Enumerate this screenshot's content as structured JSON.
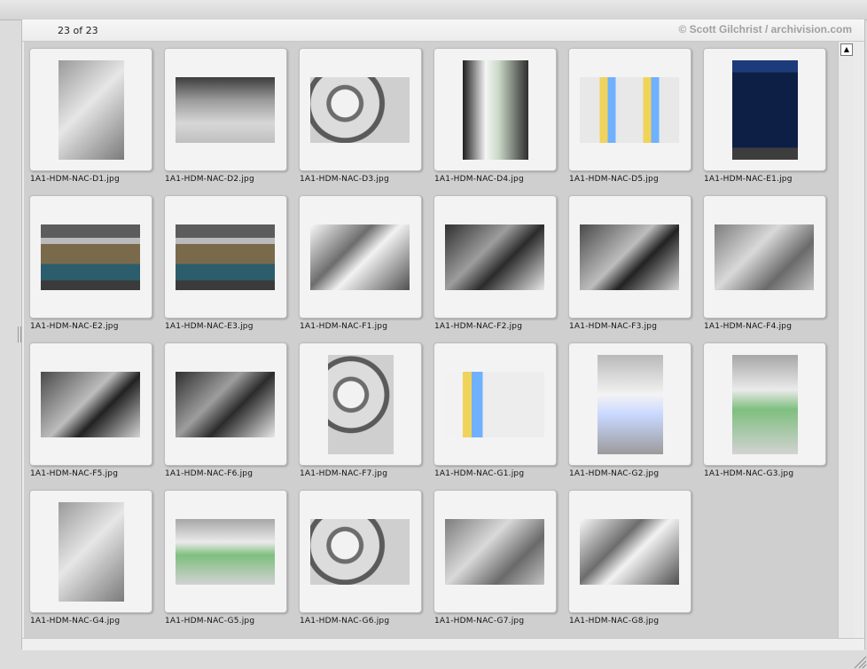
{
  "header": {
    "count": "23 of 23",
    "credit": "© Scott Gilchrist / archivision.com"
  },
  "thumbnails": [
    {
      "label": "1A1-HDM-NAC-D1.jpg",
      "icon": "photo-icon"
    },
    {
      "label": "1A1-HDM-NAC-D2.jpg",
      "icon": "photo-icon"
    },
    {
      "label": "1A1-HDM-NAC-D3.jpg",
      "icon": "photo-icon"
    },
    {
      "label": "1A1-HDM-NAC-D4.jpg",
      "icon": "photo-icon"
    },
    {
      "label": "1A1-HDM-NAC-D5.jpg",
      "icon": "photo-icon"
    },
    {
      "label": "1A1-HDM-NAC-E1.jpg",
      "icon": "photo-icon"
    },
    {
      "label": "1A1-HDM-NAC-E2.jpg",
      "icon": "photo-icon"
    },
    {
      "label": "1A1-HDM-NAC-E3.jpg",
      "icon": "photo-icon"
    },
    {
      "label": "1A1-HDM-NAC-F1.jpg",
      "icon": "photo-icon"
    },
    {
      "label": "1A1-HDM-NAC-F2.jpg",
      "icon": "photo-icon"
    },
    {
      "label": "1A1-HDM-NAC-F3.jpg",
      "icon": "photo-icon"
    },
    {
      "label": "1A1-HDM-NAC-F4.jpg",
      "icon": "photo-icon"
    },
    {
      "label": "1A1-HDM-NAC-F5.jpg",
      "icon": "photo-icon"
    },
    {
      "label": "1A1-HDM-NAC-F6.jpg",
      "icon": "photo-icon"
    },
    {
      "label": "1A1-HDM-NAC-F7.jpg",
      "icon": "photo-icon"
    },
    {
      "label": "1A1-HDM-NAC-G1.jpg",
      "icon": "photo-icon"
    },
    {
      "label": "1A1-HDM-NAC-G2.jpg",
      "icon": "photo-icon"
    },
    {
      "label": "1A1-HDM-NAC-G3.jpg",
      "icon": "photo-icon"
    },
    {
      "label": "1A1-HDM-NAC-G4.jpg",
      "icon": "photo-icon"
    },
    {
      "label": "1A1-HDM-NAC-G5.jpg",
      "icon": "photo-icon"
    },
    {
      "label": "1A1-HDM-NAC-G6.jpg",
      "icon": "photo-icon"
    },
    {
      "label": "1A1-HDM-NAC-G7.jpg",
      "icon": "photo-icon"
    },
    {
      "label": "1A1-HDM-NAC-G8.jpg",
      "icon": "photo-icon"
    }
  ],
  "scrollbar": {
    "up_icon": "scroll-up-arrow-icon"
  },
  "colors": {
    "background": "#dcdcdc",
    "frame": "#f3f3f3",
    "credit": "#a0a0a0"
  }
}
